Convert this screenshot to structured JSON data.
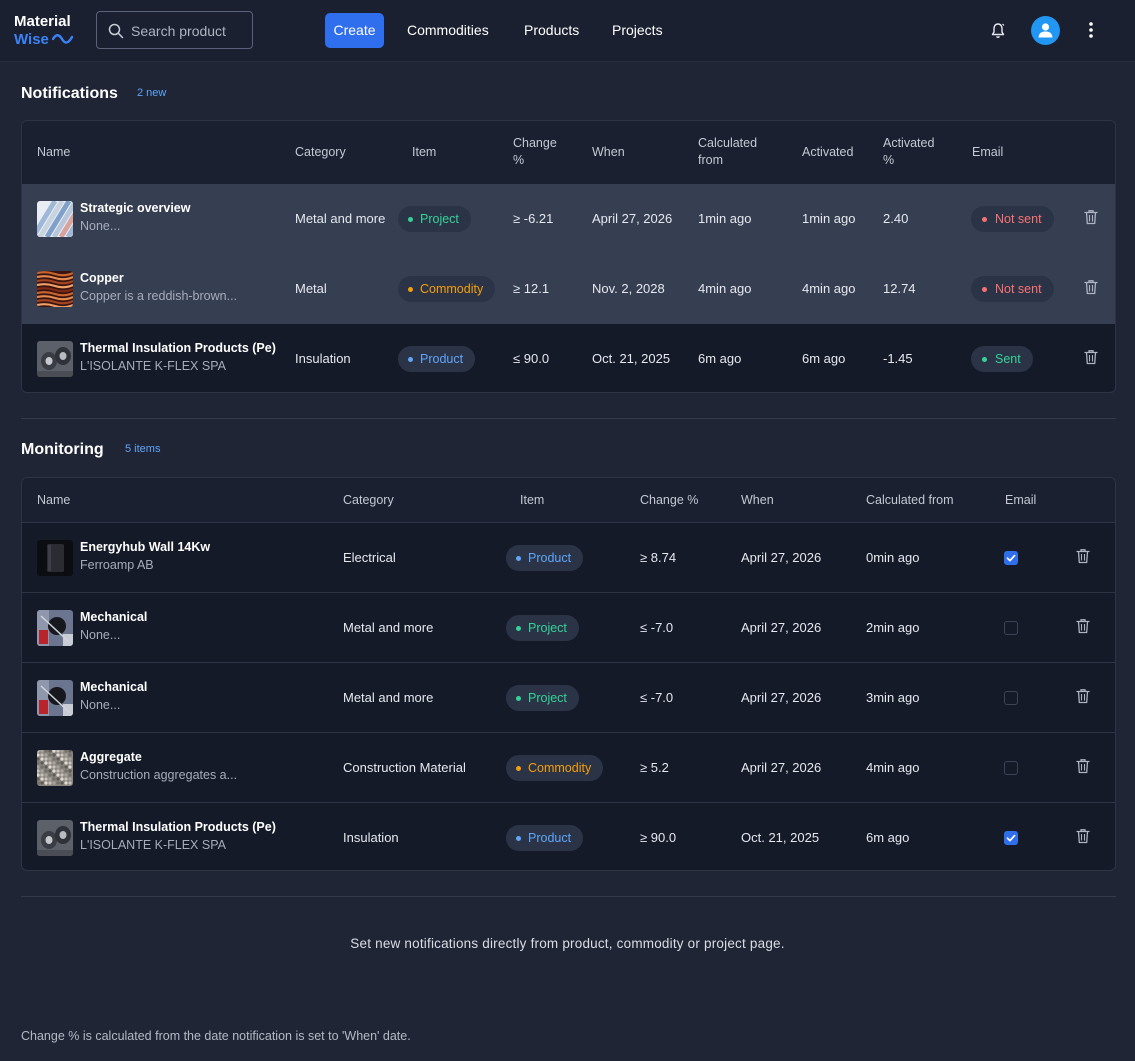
{
  "app": {
    "logo_line1": "Material",
    "logo_line2": "Wise"
  },
  "search": {
    "placeholder": "Search product"
  },
  "nav": {
    "create": "Create",
    "commodities": "Commodities",
    "products": "Products",
    "projects": "Projects"
  },
  "notifications": {
    "title": "Notifications",
    "count": "2 new",
    "headers": [
      "Name",
      "Category",
      "Item",
      "Change %",
      "When",
      "Calculated from",
      "Activated",
      "Activated %",
      "Email"
    ],
    "rows": [
      {
        "name": "Strategic overview",
        "sub": "None...",
        "thumb": "pipes",
        "category": "Metal and more",
        "item": "Project",
        "item_type": "project",
        "change": "≥ -6.21",
        "when": "April 27, 2026",
        "calc": "1min ago",
        "activated": "1min ago",
        "activated_pct": "2.40",
        "email": "Not sent",
        "email_status": "notsent",
        "highlight": true
      },
      {
        "name": "Copper",
        "sub": "Copper is a reddish-brown...",
        "thumb": "copper",
        "category": "Metal",
        "item": "Commodity",
        "item_type": "commodity",
        "change": "≥ 12.1",
        "when": "Nov. 2, 2028",
        "calc": "4min ago",
        "activated": "4min ago",
        "activated_pct": "12.74",
        "email": "Not sent",
        "email_status": "notsent",
        "highlight": true
      },
      {
        "name": "Thermal Insulation Products (Pe)",
        "sub": "L'ISOLANTE K-FLEX SPA",
        "thumb": "insulation",
        "category": "Insulation",
        "item": "Product",
        "item_type": "product",
        "change": "≤ 90.0",
        "when": "Oct. 21, 2025",
        "calc": "6m ago",
        "activated": "6m ago",
        "activated_pct": "-1.45",
        "email": "Sent",
        "email_status": "sent",
        "highlight": false
      }
    ]
  },
  "monitoring": {
    "title": "Monitoring",
    "count": "5 items",
    "headers": [
      "Name",
      "Category",
      "Item",
      "Change %",
      "When",
      "Calculated from",
      "Email"
    ],
    "rows": [
      {
        "name": "Energyhub Wall 14Kw",
        "sub": "Ferroamp AB",
        "thumb": "device",
        "category": "Electrical",
        "item": "Product",
        "item_type": "product",
        "change": "≥ 8.74",
        "when": "April 27, 2026",
        "calc": "0min ago",
        "email_checked": true
      },
      {
        "name": "Mechanical",
        "sub": "None...",
        "thumb": "mechanical",
        "category": "Metal and more",
        "item": "Project",
        "item_type": "project",
        "change": "≤ -7.0",
        "when": "April 27, 2026",
        "calc": "2min ago",
        "email_checked": false
      },
      {
        "name": "Mechanical",
        "sub": "None...",
        "thumb": "mechanical",
        "category": "Metal and more",
        "item": "Project",
        "item_type": "project",
        "change": "≤ -7.0",
        "when": "April 27, 2026",
        "calc": "3min ago",
        "email_checked": false
      },
      {
        "name": "Aggregate",
        "sub": "Construction aggregates a...",
        "thumb": "aggregate",
        "category": "Construction Material",
        "item": "Commodity",
        "item_type": "commodity",
        "change": "≥ 5.2",
        "when": "April 27, 2026",
        "calc": "4min ago",
        "email_checked": false
      },
      {
        "name": "Thermal Insulation Products (Pe)",
        "sub": "L'ISOLANTE K-FLEX SPA",
        "thumb": "insulation",
        "category": "Insulation",
        "item": "Product",
        "item_type": "product",
        "change": "≥ 90.0",
        "when": "Oct. 21, 2025",
        "calc": "6m ago",
        "email_checked": true
      }
    ]
  },
  "hint": "Set new notifications directly from product, commodity or project page.",
  "footnote": "Change % is calculated from the date notification is set to 'When' date.",
  "colors": {
    "accent": "#2f6fed",
    "project": "#34d399",
    "commodity": "#f59e0b",
    "product": "#60a5fa",
    "not_sent": "#f87171"
  }
}
